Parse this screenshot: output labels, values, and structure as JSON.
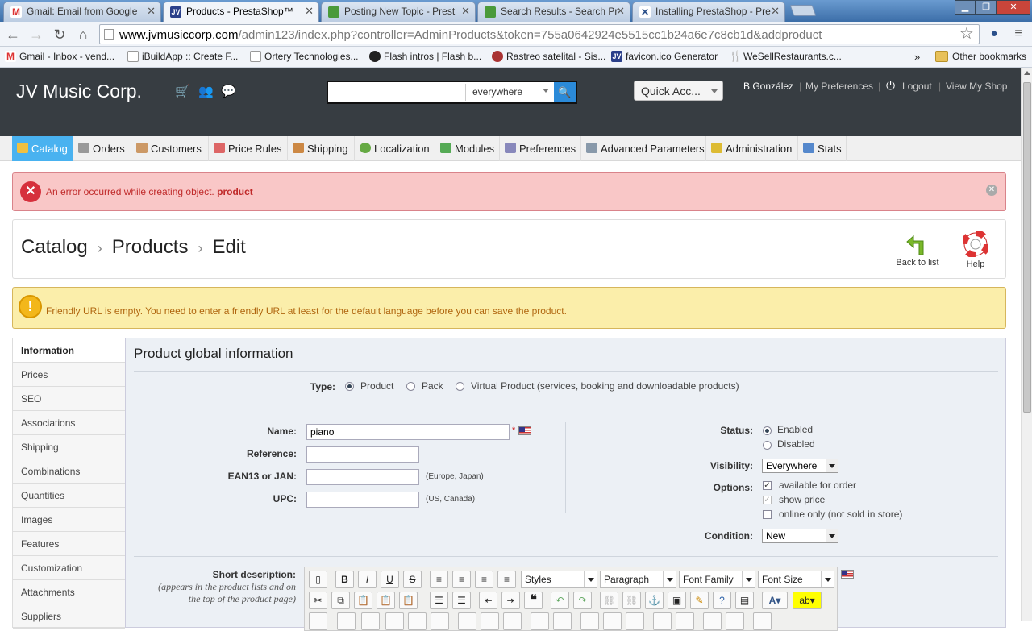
{
  "browser": {
    "tabs": [
      {
        "title": "Gmail: Email from Google",
        "icon": "gmail-icon",
        "color": "#d33"
      },
      {
        "title": "Products - PrestaShop™",
        "icon": "jv-icon",
        "color": "#2a3f8a"
      },
      {
        "title": "Posting New Topic - Prest",
        "icon": "prestashop-icon",
        "color": "#4a9a3a"
      },
      {
        "title": "Search Results - Search Pr",
        "icon": "prestashop-icon",
        "color": "#4a9a3a"
      },
      {
        "title": "Installing PrestaShop - Pre",
        "icon": "x-icon",
        "color": "#2a4f8a"
      }
    ],
    "url_host": "www.jvmusiccorp.com",
    "url_path": "/admin123/index.php?controller=AdminProducts&token=755a0642924e5515cc1b24a6e7c8cb1d&addproduct",
    "bookmarks": [
      {
        "label": "Gmail - Inbox - vend...",
        "icon": "gmail-icon",
        "color": "#d33"
      },
      {
        "label": "iBuildApp :: Create F...",
        "icon": "page-icon",
        "color": "#ddd"
      },
      {
        "label": "Ortery Technologies...",
        "icon": "page-icon",
        "color": "#ddd"
      },
      {
        "label": "Flash intros | Flash b...",
        "icon": "flash-icon",
        "color": "#222"
      },
      {
        "label": "Rastreo satelital - Sis...",
        "icon": "satellite-icon",
        "color": "#a33"
      },
      {
        "label": "favicon.ico Generator",
        "icon": "jv-icon",
        "color": "#2a3f8a"
      },
      {
        "label": "WeSellRestaurants.c...",
        "icon": "fork-icon",
        "color": "#333"
      }
    ],
    "bookmarks_more": "»",
    "other_bookmarks": "Other bookmarks"
  },
  "header": {
    "shop_name": "JV Music Corp.",
    "search_scope": "everywhere",
    "quick_access": "Quick Acc...",
    "user": "B González",
    "my_preferences": "My Preferences",
    "logout": "Logout",
    "view_shop": "View My Shop"
  },
  "menu": [
    {
      "label": "Catalog",
      "icon": "catalog-icon",
      "color": "#f0c040"
    },
    {
      "label": "Orders",
      "icon": "cart-icon",
      "color": "#999"
    },
    {
      "label": "Customers",
      "icon": "customers-icon",
      "color": "#c96"
    },
    {
      "label": "Price Rules",
      "icon": "price-rules-icon",
      "color": "#d66"
    },
    {
      "label": "Shipping",
      "icon": "truck-icon",
      "color": "#c84"
    },
    {
      "label": "Localization",
      "icon": "globe-icon",
      "color": "#6a4"
    },
    {
      "label": "Modules",
      "icon": "puzzle-icon",
      "color": "#5a5"
    },
    {
      "label": "Preferences",
      "icon": "preferences-icon",
      "color": "#88b"
    },
    {
      "label": "Advanced Parameters",
      "icon": "wrench-icon",
      "color": "#89a"
    },
    {
      "label": "Administration",
      "icon": "key-icon",
      "color": "#db3"
    },
    {
      "label": "Stats",
      "icon": "stats-icon",
      "color": "#58c"
    }
  ],
  "error": {
    "text": "An error occurred while creating object.",
    "object": "product"
  },
  "breadcrumb": {
    "level1": "Catalog",
    "level2": "Products",
    "level3": "Edit",
    "separator": "›"
  },
  "toolbar": {
    "back_label": "Back to list",
    "help_label": "Help"
  },
  "warning": {
    "text": "Friendly URL is empty. You need to enter a friendly URL at least for the default language before you can save the product."
  },
  "side_tabs": [
    "Information",
    "Prices",
    "SEO",
    "Associations",
    "Shipping",
    "Combinations",
    "Quantities",
    "Images",
    "Features",
    "Customization",
    "Attachments",
    "Suppliers"
  ],
  "form": {
    "title": "Product global information",
    "type_label": "Type:",
    "type_options": [
      "Product",
      "Pack",
      "Virtual Product (services, booking and downloadable products)"
    ],
    "type_selected": "Product",
    "name_label": "Name:",
    "name_value": "piano",
    "name_required": "*",
    "reference_label": "Reference:",
    "reference_value": "",
    "ean_label": "EAN13 or JAN:",
    "ean_value": "",
    "ean_hint": "(Europe, Japan)",
    "upc_label": "UPC:",
    "upc_value": "",
    "upc_hint": "(US, Canada)",
    "status_label": "Status:",
    "status_options": [
      "Enabled",
      "Disabled"
    ],
    "status_selected": "Enabled",
    "visibility_label": "Visibility:",
    "visibility_value": "Everywhere",
    "options_label": "Options:",
    "options": [
      {
        "label": "available for order",
        "checked": true
      },
      {
        "label": "show price",
        "checked": true
      },
      {
        "label": "online only (not sold in store)",
        "checked": false
      }
    ],
    "condition_label": "Condition:",
    "condition_value": "New",
    "short_desc_label": "Short description:",
    "short_desc_hint_1": "(appears in the product lists and on",
    "short_desc_hint_2": "the top of the product page)"
  },
  "editor": {
    "styles": "Styles",
    "format": "Paragraph",
    "font_family": "Font Family",
    "font_size": "Font Size"
  }
}
